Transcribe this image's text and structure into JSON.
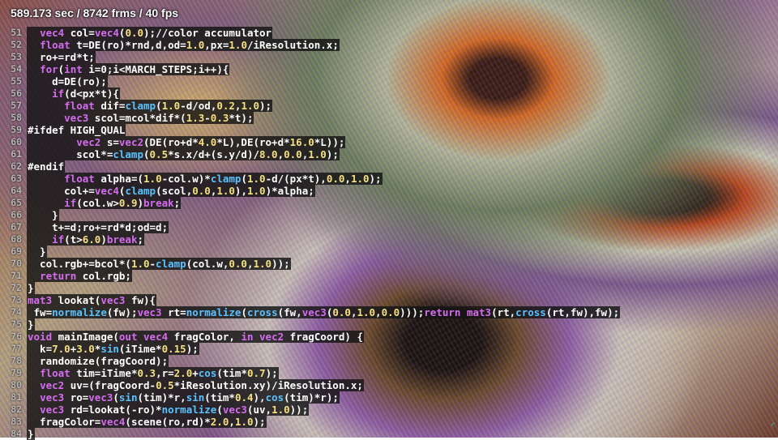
{
  "stats": {
    "text": "589.173 sec / 8742 frms / 40 fps"
  },
  "editor": {
    "lines": [
      {
        "n": "51",
        "t": "  vec4 col=vec4(0.0);//color accumulator"
      },
      {
        "n": "52",
        "t": "  float t=DE(ro)*rnd,d,od=1.0,px=1.0/iResolution.x;"
      },
      {
        "n": "53",
        "t": "  ro+=rd*t;"
      },
      {
        "n": "54",
        "t": "  for(int i=0;i<MARCH_STEPS;i++){"
      },
      {
        "n": "55",
        "t": "    d=DE(ro);"
      },
      {
        "n": "56",
        "t": "    if(d<px*t){"
      },
      {
        "n": "57",
        "t": "      float dif=clamp(1.0-d/od,0.2,1.0);"
      },
      {
        "n": "58",
        "t": "      vec3 scol=mcol*dif*(1.3-0.3*t);"
      },
      {
        "n": "59",
        "t": "#ifdef HIGH_QUAL"
      },
      {
        "n": "60",
        "t": "        vec2 s=vec2(DE(ro+d*4.0*L),DE(ro+d*16.0*L));"
      },
      {
        "n": "61",
        "t": "        scol*=clamp(0.5*s.x/d+(s.y/d)/8.0,0.0,1.0);"
      },
      {
        "n": "62",
        "t": "#endif"
      },
      {
        "n": "63",
        "t": "      float alpha=(1.0-col.w)*clamp(1.0-d/(px*t),0.0,1.0);"
      },
      {
        "n": "64",
        "t": "      col+=vec4(clamp(scol,0.0,1.0),1.0)*alpha;"
      },
      {
        "n": "65",
        "t": "      if(col.w>0.9)break;"
      },
      {
        "n": "66",
        "t": "    }"
      },
      {
        "n": "67",
        "t": "    t+=d;ro+=rd*d;od=d;"
      },
      {
        "n": "68",
        "t": "    if(t>6.0)break;"
      },
      {
        "n": "69",
        "t": "  }"
      },
      {
        "n": "70",
        "t": "  col.rgb+=bcol*(1.0-clamp(col.w,0.0,1.0));"
      },
      {
        "n": "71",
        "t": "  return col.rgb;"
      },
      {
        "n": "72",
        "t": "}"
      },
      {
        "n": "73",
        "t": "mat3 lookat(vec3 fw){"
      },
      {
        "n": "74",
        "t": " fw=normalize(fw);vec3 rt=normalize(cross(fw,vec3(0.0,1.0,0.0)));return mat3(rt,cross(rt,fw),fw);"
      },
      {
        "n": "75",
        "t": "}"
      },
      {
        "n": "76",
        "t": "void mainImage(out vec4 fragColor, in vec2 fragCoord) {"
      },
      {
        "n": "77",
        "t": "  k=7.0+3.0*sin(iTime*0.15);"
      },
      {
        "n": "78",
        "t": "  randomize(fragCoord);"
      },
      {
        "n": "79",
        "t": "  float tim=iTime*0.3,r=2.0+cos(tim*0.7);"
      },
      {
        "n": "80",
        "t": "  vec2 uv=(fragCoord-0.5*iResolution.xy)/iResolution.x;"
      },
      {
        "n": "81",
        "t": "  vec3 ro=vec3(sin(tim)*r,sin(tim*0.4),cos(tim)*r);"
      },
      {
        "n": "82",
        "t": "  vec3 rd=lookat(-ro)*normalize(vec3(uv,1.0));"
      },
      {
        "n": "83",
        "t": "  fragColor=vec4(scene(ro,rd)*2.0,1.0);"
      },
      {
        "n": "84",
        "t": "}"
      }
    ]
  },
  "corner": {
    "icon": "resize-icon"
  }
}
